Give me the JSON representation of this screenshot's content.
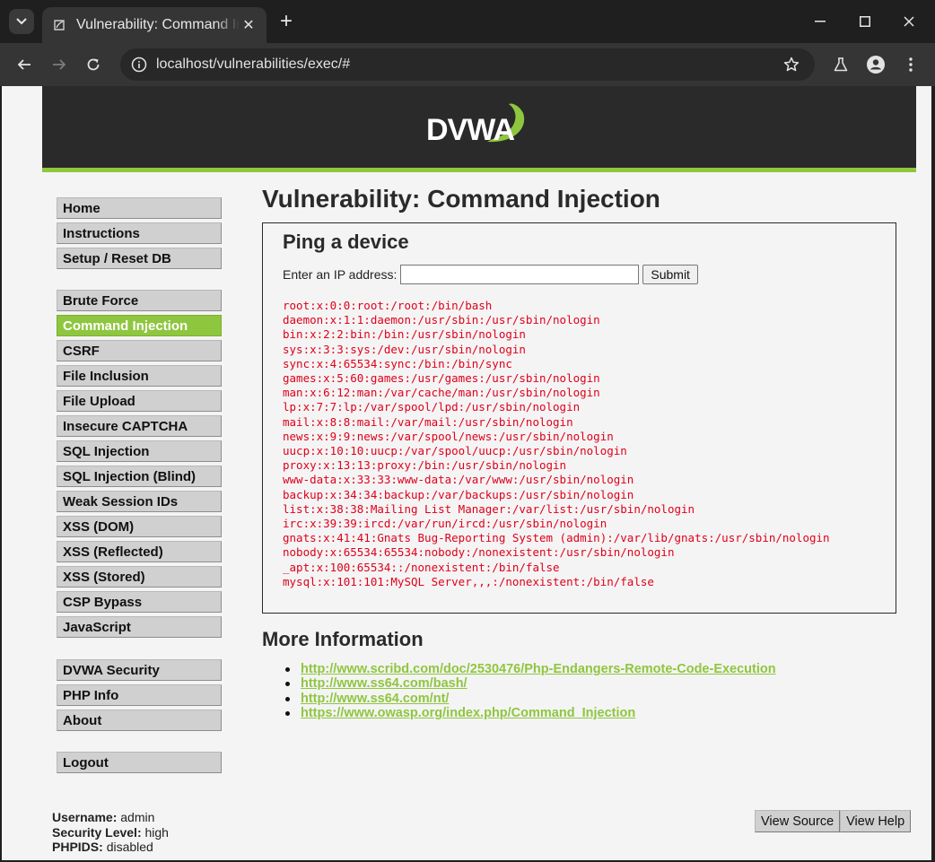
{
  "browser": {
    "tab_title": "Vulnerability: Command Injection :: Damn Vulnerable Web Application (DVWA)",
    "new_tab_symbol": "+",
    "url": "localhost/vulnerabilities/exec/#",
    "icons": [
      "chevron-down-icon",
      "favicon-icon",
      "close-icon",
      "minimize-icon",
      "maximize-icon",
      "back-icon",
      "forward-icon",
      "reload-icon",
      "site-info-icon",
      "bookmark-star-icon",
      "labs-flask-icon",
      "profile-icon",
      "more-vert-icon"
    ]
  },
  "header": {
    "logo_text": "DVWA"
  },
  "menu": {
    "items": [
      {
        "label": "Home"
      },
      {
        "label": "Instructions"
      },
      {
        "label": "Setup / Reset DB"
      },
      {
        "label": "Brute Force"
      },
      {
        "label": "Command Injection",
        "selected": true
      },
      {
        "label": "CSRF"
      },
      {
        "label": "File Inclusion"
      },
      {
        "label": "File Upload"
      },
      {
        "label": "Insecure CAPTCHA"
      },
      {
        "label": "SQL Injection"
      },
      {
        "label": "SQL Injection (Blind)"
      },
      {
        "label": "Weak Session IDs"
      },
      {
        "label": "XSS (DOM)"
      },
      {
        "label": "XSS (Reflected)"
      },
      {
        "label": "XSS (Stored)"
      },
      {
        "label": "CSP Bypass"
      },
      {
        "label": "JavaScript"
      },
      {
        "label": "DVWA Security"
      },
      {
        "label": "PHP Info"
      },
      {
        "label": "About"
      },
      {
        "label": "Logout"
      }
    ]
  },
  "main": {
    "title": "Vulnerability: Command Injection",
    "box_title": "Ping a device",
    "ip_label": "Enter an IP address:",
    "ip_value": "",
    "submit_label": "Submit",
    "output_lines": [
      "root:x:0:0:root:/root:/bin/bash",
      "daemon:x:1:1:daemon:/usr/sbin:/usr/sbin/nologin",
      "bin:x:2:2:bin:/bin:/usr/sbin/nologin",
      "sys:x:3:3:sys:/dev:/usr/sbin/nologin",
      "sync:x:4:65534:sync:/bin:/bin/sync",
      "games:x:5:60:games:/usr/games:/usr/sbin/nologin",
      "man:x:6:12:man:/var/cache/man:/usr/sbin/nologin",
      "lp:x:7:7:lp:/var/spool/lpd:/usr/sbin/nologin",
      "mail:x:8:8:mail:/var/mail:/usr/sbin/nologin",
      "news:x:9:9:news:/var/spool/news:/usr/sbin/nologin",
      "uucp:x:10:10:uucp:/var/spool/uucp:/usr/sbin/nologin",
      "proxy:x:13:13:proxy:/bin:/usr/sbin/nologin",
      "www-data:x:33:33:www-data:/var/www:/usr/sbin/nologin",
      "backup:x:34:34:backup:/var/backups:/usr/sbin/nologin",
      "list:x:38:38:Mailing List Manager:/var/list:/usr/sbin/nologin",
      "irc:x:39:39:ircd:/var/run/ircd:/usr/sbin/nologin",
      "gnats:x:41:41:Gnats Bug-Reporting System (admin):/var/lib/gnats:/usr/sbin/nologin",
      "nobody:x:65534:65534:nobody:/nonexistent:/usr/sbin/nologin",
      "_apt:x:100:65534::/nonexistent:/bin/false",
      "mysql:x:101:101:MySQL Server,,,:/nonexistent:/bin/false"
    ],
    "more_info_title": "More Information",
    "links": [
      "http://www.scribd.com/doc/2530476/Php-Endangers-Remote-Code-Execution",
      "http://www.ss64.com/bash/",
      "http://www.ss64.com/nt/",
      "https://www.owasp.org/index.php/Command_Injection"
    ]
  },
  "footer": {
    "username_label": "Username:",
    "username": "admin",
    "security_label": "Security Level:",
    "security": "high",
    "phpids_label": "PHPIDS:",
    "phpids": "disabled",
    "view_source_label": "View Source",
    "view_help_label": "View Help"
  },
  "colors": {
    "accent_green": "#8fc63f",
    "header_dark": "#2a2a2a",
    "output_red": "#e0001b"
  }
}
